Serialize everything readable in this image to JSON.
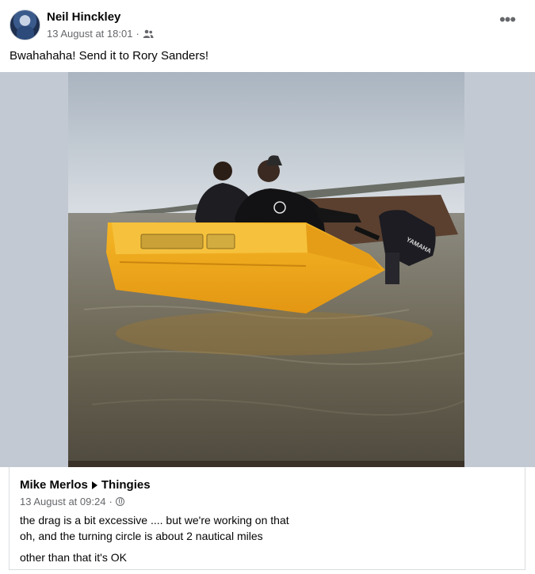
{
  "post": {
    "author": "Neil Hinckley",
    "timestamp": "13 August at 18:01",
    "separator": "·",
    "audience_icon": "friends-icon",
    "more_label": "•••",
    "caption": "Bwahahaha! Send it to Rory Sanders!"
  },
  "photo": {
    "description_icon": "photo",
    "motor_brand": "YAMAHA"
  },
  "shared": {
    "author": "Mike Merlos",
    "group": "Thingies",
    "timestamp": "13 August at 09:24",
    "separator": "·",
    "audience_icon": "globe-icon",
    "lines": [
      "the drag is a bit excessive .... but we're working on that",
      "oh, and the turning circle is about 2 nautical miles",
      "other than that it's OK"
    ]
  },
  "colors": {
    "text": "#050505",
    "secondary": "#65676b",
    "skip": "#f2a51a",
    "water": "#6f6a5a",
    "sky": "#cfd6de"
  }
}
